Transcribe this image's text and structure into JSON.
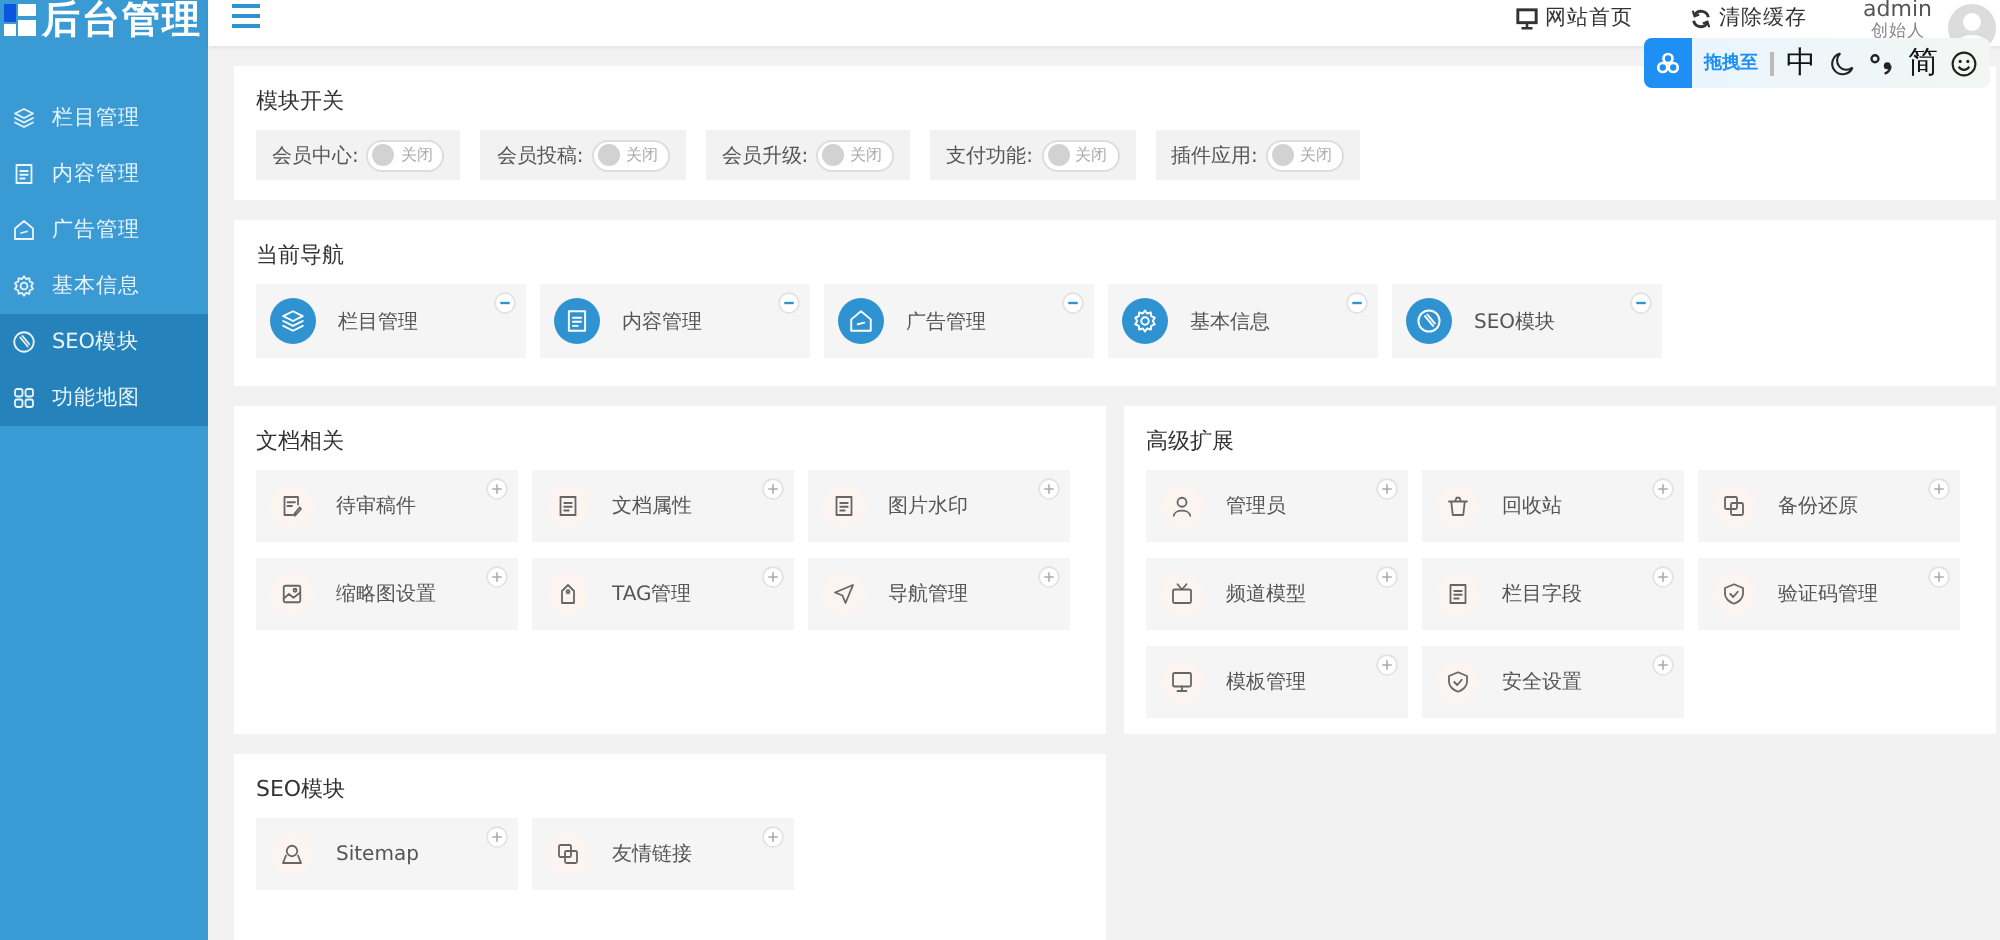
{
  "logo": {
    "text": "后台管理"
  },
  "sidebar": {
    "items": [
      {
        "label": "栏目管理",
        "selected": false
      },
      {
        "label": "内容管理",
        "selected": false
      },
      {
        "label": "广告管理",
        "selected": false
      },
      {
        "label": "基本信息",
        "selected": false
      },
      {
        "label": "SEO模块",
        "selected": true
      },
      {
        "label": "功能地图",
        "selected": true
      }
    ]
  },
  "header": {
    "links": [
      "网站首页",
      "清除缓存"
    ],
    "user": {
      "name": "admin",
      "role": "创始人"
    }
  },
  "ime_bar": {
    "hint": "拖拽至",
    "chars": [
      "中",
      "简"
    ]
  },
  "module_switches": {
    "title": "模块开关",
    "items": [
      {
        "label": "会员中心:",
        "on": false,
        "state_text": "关闭"
      },
      {
        "label": "会员投稿:",
        "on": false,
        "state_text": "关闭"
      },
      {
        "label": "会员升级:",
        "on": false,
        "state_text": "关闭"
      },
      {
        "label": "支付功能:",
        "on": false,
        "state_text": "关闭"
      },
      {
        "label": "插件应用:",
        "on": false,
        "state_text": "关闭"
      }
    ]
  },
  "current_nav": {
    "title": "当前导航",
    "items": [
      "栏目管理",
      "内容管理",
      "广告管理",
      "基本信息",
      "SEO模块"
    ]
  },
  "doc_section": {
    "title": "文档相关",
    "items": [
      "待审稿件",
      "文档属性",
      "图片水印",
      "缩略图设置",
      "TAG管理",
      "导航管理"
    ]
  },
  "advanced_section": {
    "title": "高级扩展",
    "items": [
      "管理员",
      "回收站",
      "备份还原",
      "频道模型",
      "栏目字段",
      "验证码管理",
      "模板管理",
      "安全设置"
    ]
  },
  "seo_section": {
    "title": "SEO模块",
    "items": [
      "Sitemap",
      "友情链接"
    ]
  }
}
